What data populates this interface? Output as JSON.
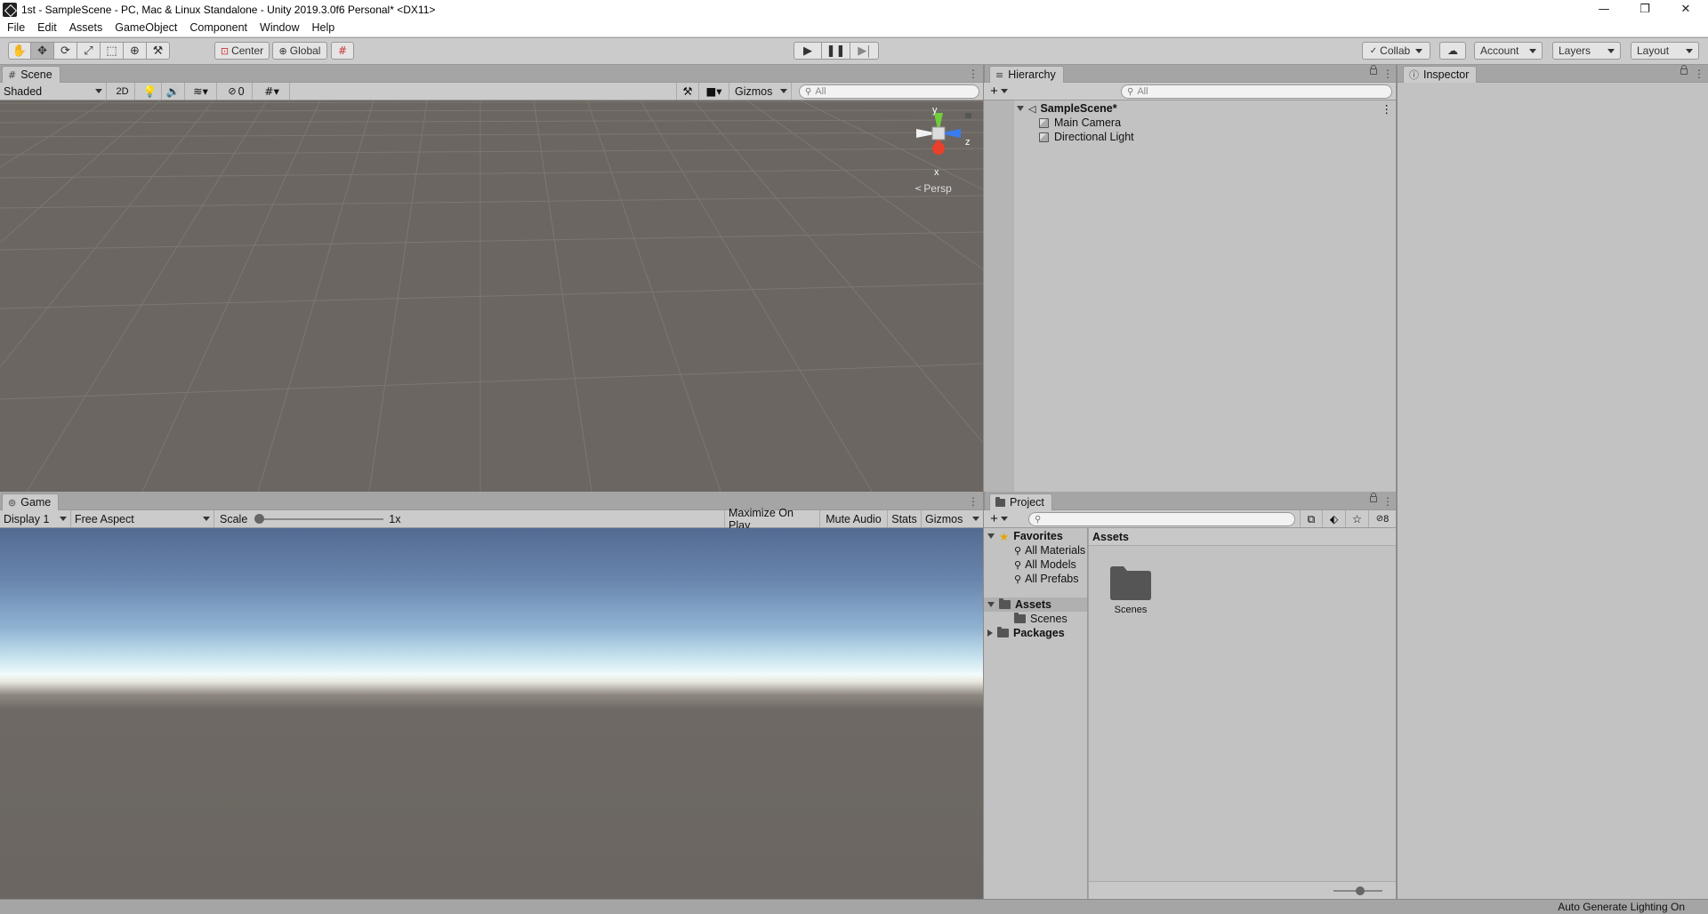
{
  "window": {
    "title": "1st - SampleScene - PC, Mac & Linux Standalone - Unity 2019.3.0f6 Personal* <DX11>",
    "minimize_glyph": "—",
    "maximize_glyph": "❐",
    "close_glyph": "✕"
  },
  "menu": [
    "File",
    "Edit",
    "Assets",
    "GameObject",
    "Component",
    "Window",
    "Help"
  ],
  "toolbar": {
    "pivot_label": "Center",
    "space_label": "Global",
    "collab_label": "Collab",
    "account_label": "Account",
    "layers_label": "Layers",
    "layout_label": "Layout"
  },
  "scene": {
    "tab_label": "Scene",
    "draw_mode": "Shaded",
    "twod_label": "2D",
    "hidden_count": "0",
    "gizmos_label": "Gizmos",
    "search_placeholder": "All",
    "axis_y": "y",
    "axis_z": "z",
    "axis_x": "x",
    "projection_label": "Persp"
  },
  "game": {
    "tab_label": "Game",
    "display": "Display 1",
    "aspect": "Free Aspect",
    "scale_label": "Scale",
    "scale_value": "1x",
    "maximize_label": "Maximize On Play",
    "mute_label": "Mute Audio",
    "stats_label": "Stats",
    "gizmos_label": "Gizmos"
  },
  "hierarchy": {
    "tab_label": "Hierarchy",
    "search_placeholder": "All",
    "scene_name": "SampleScene*",
    "objects": [
      "Main Camera",
      "Directional Light"
    ]
  },
  "inspector": {
    "tab_label": "Inspector"
  },
  "project": {
    "tab_label": "Project",
    "hidden_count": "8",
    "favorites_label": "Favorites",
    "favorites": [
      "All Materials",
      "All Models",
      "All Prefabs"
    ],
    "assets_label": "Assets",
    "asset_folders": [
      "Scenes"
    ],
    "packages_label": "Packages",
    "breadcrumb": "Assets",
    "grid_items": [
      "Scenes"
    ]
  },
  "status": {
    "right_text": "Auto Generate Lighting On"
  },
  "colors": {
    "scene_bg": "#6b6661",
    "axis_y": "#6fce3a",
    "axis_z": "#3a7cf0",
    "axis_x": "#e8402a",
    "panel_bg": "#c2c2c2"
  }
}
